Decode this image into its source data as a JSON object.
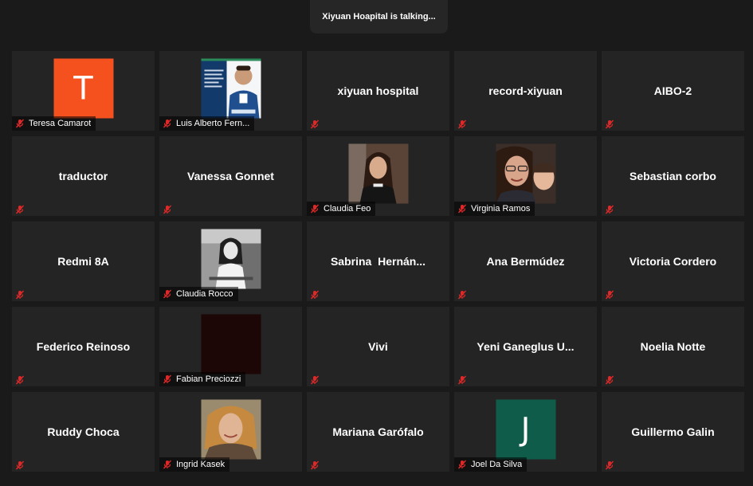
{
  "banner": {
    "text": "Xiyuan Hoapital is talking..."
  },
  "colors": {
    "tile_bg": "#242424",
    "page_bg": "#1a1a1a",
    "mute_red": "#e02828",
    "avatar_orange": "#f4511e",
    "avatar_green": "#0f5c4a"
  },
  "participants": [
    {
      "name": "Teresa Camarot",
      "avatar": "T"
    },
    {
      "name": "Luis Alberto Fern..."
    },
    {
      "name": "xiyuan hospital"
    },
    {
      "name": "record-xiyuan"
    },
    {
      "name": "AIBO-2"
    },
    {
      "name": "traductor"
    },
    {
      "name": "Vanessa Gonnet"
    },
    {
      "name": "Claudia Feo"
    },
    {
      "name": "Virginia Ramos"
    },
    {
      "name": "Sebastian corbo"
    },
    {
      "name": "Redmi 8A"
    },
    {
      "name": "Claudia Rocco"
    },
    {
      "name": "Sabrina  Hernán..."
    },
    {
      "name": "Ana Bermúdez"
    },
    {
      "name": "Victoria Cordero"
    },
    {
      "name": "Federico Reinoso"
    },
    {
      "name": "Fabian Preciozzi"
    },
    {
      "name": "Vivi"
    },
    {
      "name": "Yeni Ganeglus U..."
    },
    {
      "name": "Noelia Notte"
    },
    {
      "name": "Ruddy Choca"
    },
    {
      "name": "Ingrid Kasek"
    },
    {
      "name": "Mariana Garófalo"
    },
    {
      "name": "Joel Da Silva",
      "avatar": "J"
    },
    {
      "name": "Guillermo Galin"
    }
  ]
}
